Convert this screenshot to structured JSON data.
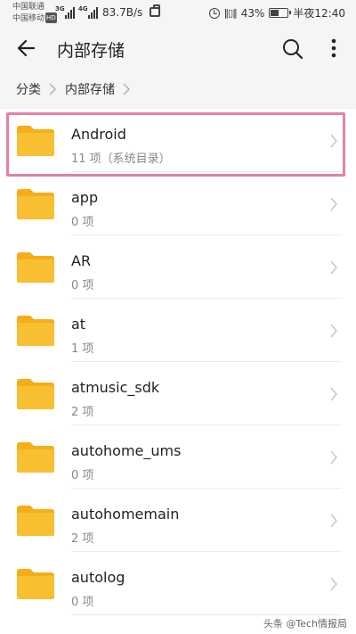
{
  "status_bar": {
    "carrier_1": "中国联通",
    "carrier_2": "中国移动",
    "carrier_2_badge": "HD",
    "sig1_gen": "3G",
    "sig2_gen": "4G",
    "net_speed": "83.7B/s",
    "battery": "43%",
    "battery_level": 0.43,
    "time": "半夜12:40",
    "icons": [
      "signal-icon",
      "bag-icon",
      "alarm-icon",
      "vibrate-icon",
      "battery-icon"
    ]
  },
  "header": {
    "title": "内部存储",
    "icons": [
      "back-arrow-icon",
      "search-icon",
      "more-vertical-icon"
    ]
  },
  "breadcrumb": {
    "items": [
      "分类",
      "内部存储"
    ]
  },
  "files": [
    {
      "name": "Android",
      "meta": "11 项（系统目录）"
    },
    {
      "name": "app",
      "meta": "0 项"
    },
    {
      "name": "AR",
      "meta": "0 项"
    },
    {
      "name": "at",
      "meta": "1 项"
    },
    {
      "name": "atmusic_sdk",
      "meta": "2 项"
    },
    {
      "name": "autohome_ums",
      "meta": "0 项"
    },
    {
      "name": "autohomemain",
      "meta": "2 项"
    },
    {
      "name": "autolog",
      "meta": "0 项"
    }
  ],
  "colors": {
    "folder": "#F8BF32",
    "folder_tab": "#F5AE17",
    "highlight": "#E57FA9"
  },
  "watermark": "头条 @Tech情报局"
}
